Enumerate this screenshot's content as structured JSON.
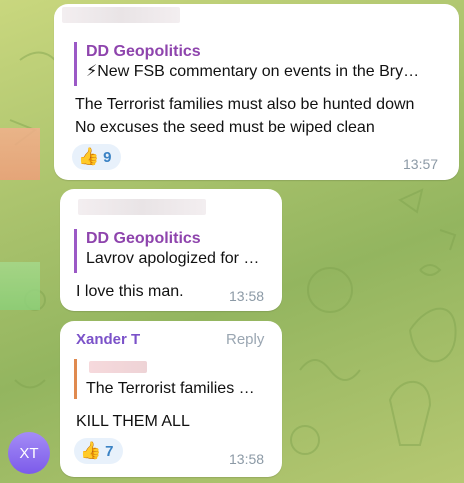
{
  "messages": [
    {
      "quote": {
        "title": "DD Geopolitics",
        "text": "⚡New FSB commentary on events in the Bry…"
      },
      "text_lines": [
        "The Terrorist families must also be hunted down",
        "No excuses the seed must be wiped clean"
      ],
      "reaction": {
        "emoji": "👍",
        "count": "9"
      },
      "time": "13:57"
    },
    {
      "quote": {
        "title": "DD Geopolitics",
        "text": "Lavrov apologized for …"
      },
      "text_lines": [
        "I love this man."
      ],
      "time": "13:58"
    },
    {
      "sender": "Xander T",
      "reply_label": "Reply",
      "quote": {
        "text": "The Terrorist families …"
      },
      "text_lines": [
        "KILL THEM ALL"
      ],
      "reaction": {
        "emoji": "👍",
        "count": "7"
      },
      "time": "13:58",
      "avatar_initials": "XT"
    }
  ],
  "colors": {
    "accent": "#8e44ad",
    "reaction_count": "#3a82c4",
    "timestamp": "#8c9aa6",
    "avatar": "#8b6cf0"
  }
}
